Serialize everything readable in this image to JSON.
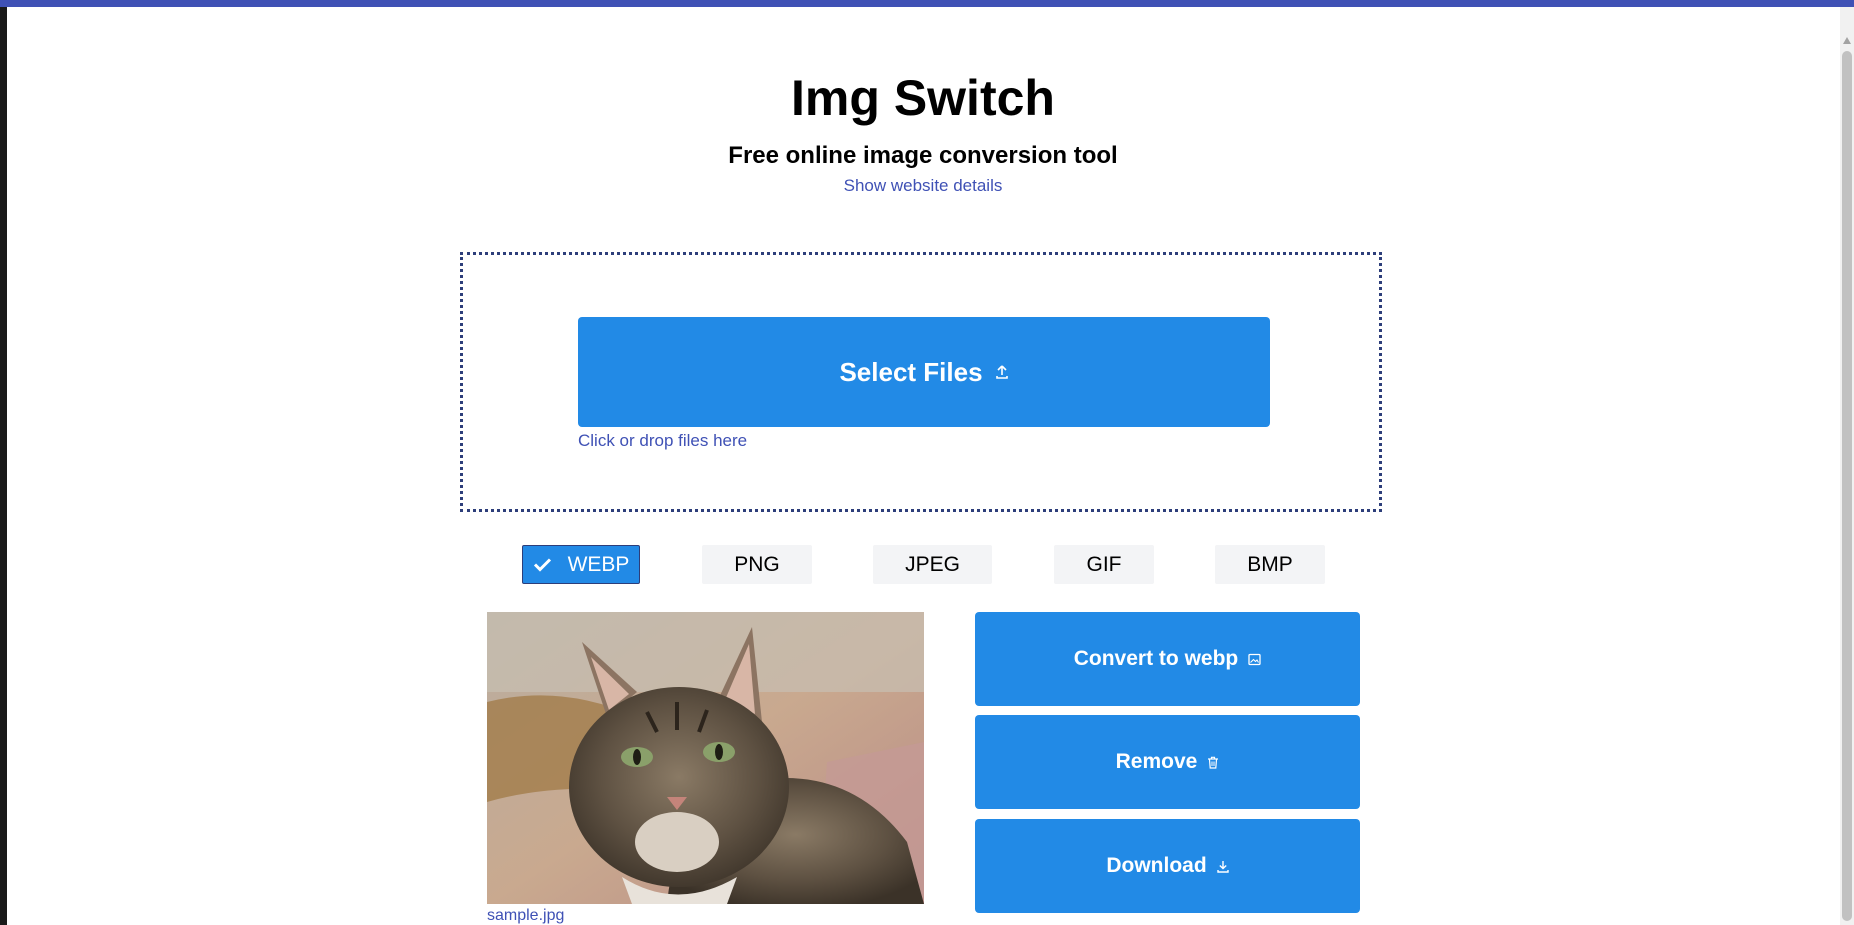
{
  "header": {
    "title": "Img Switch",
    "subtitle": "Free online image conversion tool",
    "details_link": "Show website details"
  },
  "upload": {
    "select_label": "Select Files",
    "hint": "Click or drop files here"
  },
  "formats": [
    {
      "label": "WEBP",
      "selected": true
    },
    {
      "label": "PNG",
      "selected": false
    },
    {
      "label": "JPEG",
      "selected": false
    },
    {
      "label": "GIF",
      "selected": false
    },
    {
      "label": "BMP",
      "selected": false
    }
  ],
  "file": {
    "name": "sample.jpg"
  },
  "actions": {
    "convert_label": "Convert to webp",
    "remove_label": "Remove",
    "download_label": "Download"
  },
  "colors": {
    "accent": "#228ae6",
    "brand": "#3f51b5",
    "border": "#2d3e7a"
  },
  "icons": {
    "select": "upload-icon",
    "selected_format": "checkmark-icon",
    "convert": "image-icon",
    "remove": "trash-icon",
    "download": "download-icon"
  }
}
